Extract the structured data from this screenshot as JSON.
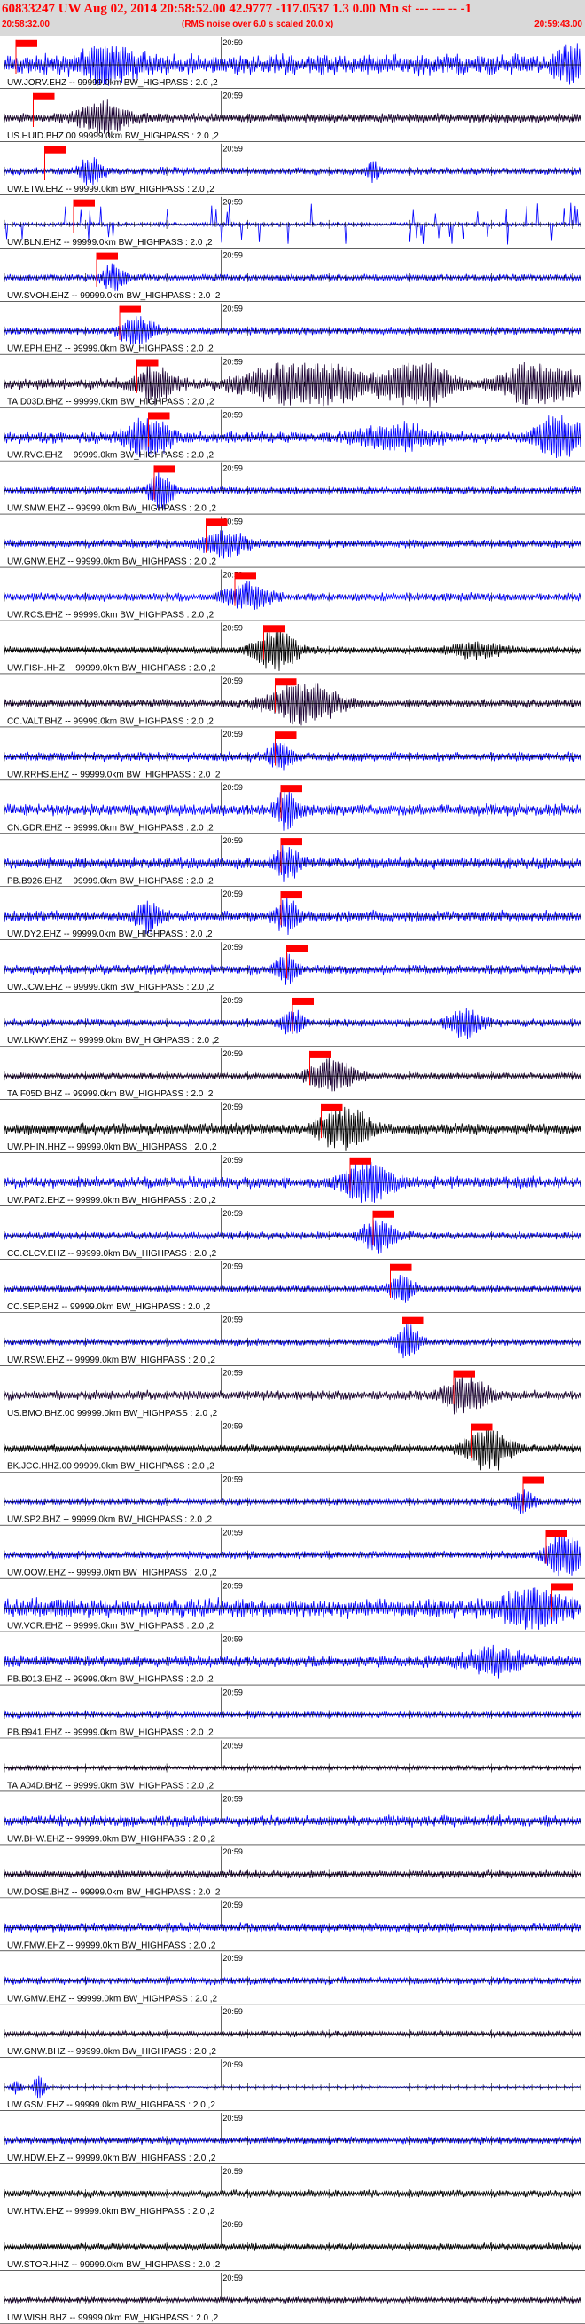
{
  "header": {
    "title": "60833247 UW Aug 02, 2014 20:58:52.00    42.9777 -117.0537  1.3 0.00 Mn st --- --- --  -1",
    "start_time": "20:58:32.00",
    "note": "(RMS noise over 6.0 s scaled 20.0 x)",
    "end_time": "20:59:43.00"
  },
  "chart_data": {
    "type": "line",
    "time_axis": {
      "start": "20:58:32.00",
      "end": "20:59:43.00",
      "tick_label": "20:59"
    },
    "colors": {
      "blue": "#0000ff",
      "dark": "#1a0033",
      "black": "#000000",
      "red": "#ff0000",
      "axis": "#000000"
    },
    "traces": [
      {
        "label": "UW.JORV.EHZ -- 99999.0km BW_HIGHPASS : 2.0 ,2",
        "color": "blue",
        "amplitude": 0.55,
        "pick": 0.02,
        "bursts": [
          [
            0.18,
            0.7,
            0.05
          ],
          [
            0.98,
            0.8,
            0.02
          ]
        ]
      },
      {
        "label": "US.HUID.BHZ.00 99999.0km BW_HIGHPASS : 2.0 ,2",
        "color": "dark",
        "amplitude": 0.25,
        "pick": 0.05,
        "bursts": [
          [
            0.17,
            0.7,
            0.04
          ]
        ]
      },
      {
        "label": "UW.ETW.EHZ -- 99999.0km BW_HIGHPASS : 2.0 ,2",
        "color": "blue",
        "amplitude": 0.2,
        "pick": 0.07,
        "bursts": [
          [
            0.15,
            0.6,
            0.02
          ],
          [
            0.64,
            0.5,
            0.01
          ]
        ]
      },
      {
        "label": "UW.BLN.EHZ -- 99999.0km BW_HIGHPASS : 2.0 ,2",
        "color": "blue",
        "amplitude": 0.1,
        "pick": 0.12,
        "spikes": true,
        "bursts": []
      },
      {
        "label": "UW.SVOH.EHZ -- 99999.0km BW_HIGHPASS : 2.0 ,2",
        "color": "blue",
        "amplitude": 0.18,
        "pick": 0.16,
        "bursts": [
          [
            0.19,
            0.6,
            0.02
          ]
        ]
      },
      {
        "label": "UW.EPH.EHZ -- 99999.0km BW_HIGHPASS : 2.0 ,2",
        "color": "blue",
        "amplitude": 0.2,
        "pick": 0.2,
        "bursts": [
          [
            0.23,
            0.6,
            0.03
          ]
        ]
      },
      {
        "label": "TA.D03D.BHZ -- 99999.0km BW_HIGHPASS : 2.0 ,2",
        "color": "dark",
        "amplitude": 0.3,
        "pick": 0.23,
        "bursts": [
          [
            0.26,
            0.8,
            0.03
          ],
          [
            0.53,
            1.0,
            0.1
          ],
          [
            0.72,
            1.0,
            0.05
          ],
          [
            0.93,
            1.0,
            0.06
          ]
        ]
      },
      {
        "label": "UW.RVC.EHZ -- 99999.0km BW_HIGHPASS : 2.0 ,2",
        "color": "blue",
        "amplitude": 0.3,
        "pick": 0.25,
        "bursts": [
          [
            0.25,
            0.8,
            0.04
          ],
          [
            0.68,
            0.5,
            0.06
          ],
          [
            0.96,
            0.95,
            0.04
          ]
        ]
      },
      {
        "label": "UW.SMW.EHZ -- 99999.0km BW_HIGHPASS : 2.0 ,2",
        "color": "blue",
        "amplitude": 0.2,
        "pick": 0.26,
        "bursts": [
          [
            0.27,
            0.9,
            0.02
          ]
        ]
      },
      {
        "label": "UW.GNW.EHZ -- 99999.0km BW_HIGHPASS : 2.0 ,2",
        "color": "blue",
        "amplitude": 0.22,
        "pick": 0.35,
        "bursts": [
          [
            0.38,
            0.5,
            0.04
          ]
        ]
      },
      {
        "label": "UW.RCS.EHZ -- 99999.0km BW_HIGHPASS : 2.0 ,2",
        "color": "blue",
        "amplitude": 0.22,
        "pick": 0.4,
        "bursts": [
          [
            0.42,
            0.5,
            0.04
          ]
        ]
      },
      {
        "label": "UW.FISH.HHZ -- 99999.0km BW_HIGHPASS : 2.0 ,2",
        "color": "black",
        "amplitude": 0.18,
        "pick": 0.45,
        "bursts": [
          [
            0.47,
            0.8,
            0.04
          ],
          [
            0.82,
            0.3,
            0.05
          ]
        ]
      },
      {
        "label": "CC.VALT.BHZ -- 99999.0km BW_HIGHPASS : 2.0 ,2",
        "color": "dark",
        "amplitude": 0.22,
        "pick": 0.47,
        "bursts": [
          [
            0.52,
            0.9,
            0.06
          ]
        ]
      },
      {
        "label": "UW.RRHS.EHZ -- 99999.0km BW_HIGHPASS : 2.0 ,2",
        "color": "blue",
        "amplitude": 0.25,
        "pick": 0.47,
        "bursts": [
          [
            0.48,
            0.6,
            0.02
          ]
        ]
      },
      {
        "label": "CN.GDR.EHZ -- 99999.0km BW_HIGHPASS : 2.0 ,2",
        "color": "blue",
        "amplitude": 0.3,
        "pick": 0.48,
        "bursts": [
          [
            0.49,
            0.8,
            0.02
          ]
        ]
      },
      {
        "label": "PB.B926.EHZ -- 99999.0km BW_HIGHPASS : 2.0 ,2",
        "color": "blue",
        "amplitude": 0.3,
        "pick": 0.48,
        "bursts": [
          [
            0.49,
            0.7,
            0.02
          ]
        ]
      },
      {
        "label": "UW.DY2.EHZ -- 99999.0km BW_HIGHPASS : 2.0 ,2",
        "color": "blue",
        "amplitude": 0.3,
        "pick": 0.48,
        "bursts": [
          [
            0.49,
            0.7,
            0.02
          ],
          [
            0.25,
            0.6,
            0.02
          ]
        ]
      },
      {
        "label": "UW.JCW.EHZ -- 99999.0km BW_HIGHPASS : 2.0 ,2",
        "color": "blue",
        "amplitude": 0.25,
        "pick": 0.49,
        "bursts": [
          [
            0.49,
            0.6,
            0.02
          ]
        ]
      },
      {
        "label": "UW.LKWY.EHZ -- 99999.0km BW_HIGHPASS : 2.0 ,2",
        "color": "blue",
        "amplitude": 0.2,
        "pick": 0.5,
        "bursts": [
          [
            0.5,
            0.5,
            0.02
          ],
          [
            0.8,
            0.6,
            0.03
          ]
        ]
      },
      {
        "label": "TA.F05D.BHZ -- 99999.0km BW_HIGHPASS : 2.0 ,2",
        "color": "dark",
        "amplitude": 0.18,
        "pick": 0.53,
        "bursts": [
          [
            0.57,
            0.7,
            0.04
          ]
        ]
      },
      {
        "label": "UW.PHIN.HHZ -- 99999.0km BW_HIGHPASS : 2.0 ,2",
        "color": "black",
        "amplitude": 0.3,
        "pick": 0.55,
        "bursts": [
          [
            0.59,
            1.0,
            0.04
          ]
        ]
      },
      {
        "label": "UW.PAT2.EHZ -- 99999.0km BW_HIGHPASS : 2.0 ,2",
        "color": "blue",
        "amplitude": 0.3,
        "pick": 0.6,
        "bursts": [
          [
            0.63,
            0.9,
            0.04
          ]
        ]
      },
      {
        "label": "CC.CLCV.EHZ -- 99999.0km BW_HIGHPASS : 2.0 ,2",
        "color": "blue",
        "amplitude": 0.2,
        "pick": 0.64,
        "bursts": [
          [
            0.65,
            0.7,
            0.03
          ]
        ]
      },
      {
        "label": "CC.SEP.EHZ -- 99999.0km BW_HIGHPASS : 2.0 ,2",
        "color": "blue",
        "amplitude": 0.18,
        "pick": 0.67,
        "bursts": [
          [
            0.69,
            0.6,
            0.02
          ]
        ]
      },
      {
        "label": "UW.RSW.EHZ -- 99999.0km BW_HIGHPASS : 2.0 ,2",
        "color": "blue",
        "amplitude": 0.18,
        "pick": 0.69,
        "bursts": [
          [
            0.7,
            0.8,
            0.02
          ]
        ]
      },
      {
        "label": "US.BMO.BHZ.00 99999.0km BW_HIGHPASS : 2.0 ,2",
        "color": "dark",
        "amplitude": 0.25,
        "pick": 0.78,
        "bursts": [
          [
            0.8,
            0.8,
            0.04
          ]
        ]
      },
      {
        "label": "BK.JCC.HHZ.00 99999.0km BW_HIGHPASS : 2.0 ,2",
        "color": "black",
        "amplitude": 0.2,
        "pick": 0.81,
        "bursts": [
          [
            0.84,
            1.0,
            0.04
          ]
        ]
      },
      {
        "label": "UW.SP2.BHZ -- 99999.0km BW_HIGHPASS : 2.0 ,2",
        "color": "blue",
        "amplitude": 0.15,
        "pick": 0.9,
        "bursts": [
          [
            0.9,
            0.5,
            0.02
          ]
        ]
      },
      {
        "label": "UW.OOW.EHZ -- 99999.0km BW_HIGHPASS : 2.0 ,2",
        "color": "blue",
        "amplitude": 0.2,
        "pick": 0.94,
        "bursts": [
          [
            0.97,
            1.0,
            0.03
          ]
        ]
      },
      {
        "label": "UW.VCR.EHZ -- 99999.0km BW_HIGHPASS : 2.0 ,2",
        "color": "blue",
        "amplitude": 0.5,
        "pick": 0.95,
        "bursts": [
          [
            0.92,
            0.8,
            0.05
          ]
        ]
      },
      {
        "label": "PB.B013.EHZ -- 99999.0km BW_HIGHPASS : 2.0 ,2",
        "color": "blue",
        "amplitude": 0.3,
        "pick": null,
        "bursts": [
          [
            0.85,
            0.5,
            0.05
          ]
        ]
      },
      {
        "label": "PB.B941.EHZ -- 99999.0km BW_HIGHPASS : 2.0 ,2",
        "color": "blue",
        "amplitude": 0.15,
        "pick": null,
        "bursts": []
      },
      {
        "label": "TA.A04D.BHZ -- 99999.0km BW_HIGHPASS : 2.0 ,2",
        "color": "dark",
        "amplitude": 0.12,
        "pick": null,
        "bursts": []
      },
      {
        "label": "UW.BHW.EHZ -- 99999.0km BW_HIGHPASS : 2.0 ,2",
        "color": "blue",
        "amplitude": 0.3,
        "pick": null,
        "bursts": []
      },
      {
        "label": "UW.DOSE.BHZ -- 99999.0km BW_HIGHPASS : 2.0 ,2",
        "color": "dark",
        "amplitude": 0.2,
        "pick": null,
        "bursts": []
      },
      {
        "label": "UW.FMW.EHZ -- 99999.0km BW_HIGHPASS : 2.0 ,2",
        "color": "blue",
        "amplitude": 0.25,
        "pick": null,
        "bursts": []
      },
      {
        "label": "UW.GMW.EHZ -- 99999.0km BW_HIGHPASS : 2.0 ,2",
        "color": "blue",
        "amplitude": 0.2,
        "pick": null,
        "bursts": []
      },
      {
        "label": "UW.GNW.BHZ -- 99999.0km BW_HIGHPASS : 2.0 ,2",
        "color": "dark",
        "amplitude": 0.15,
        "pick": null,
        "bursts": []
      },
      {
        "label": "UW.GSM.EHZ -- 99999.0km BW_HIGHPASS : 2.0 ,2",
        "color": "blue",
        "amplitude": 0.05,
        "pick": null,
        "bursts": [
          [
            0.06,
            0.6,
            0.01
          ],
          [
            0.02,
            0.3,
            0.01
          ]
        ]
      },
      {
        "label": "UW.HDW.EHZ -- 99999.0km BW_HIGHPASS : 2.0 ,2",
        "color": "blue",
        "amplitude": 0.2,
        "pick": null,
        "bursts": []
      },
      {
        "label": "UW.HTW.EHZ -- 99999.0km BW_HIGHPASS : 2.0 ,2",
        "color": "black",
        "amplitude": 0.2,
        "pick": null,
        "bursts": []
      },
      {
        "label": "UW.STOR.HHZ -- 99999.0km BW_HIGHPASS : 2.0 ,2",
        "color": "black",
        "amplitude": 0.2,
        "pick": null,
        "bursts": []
      },
      {
        "label": "UW.WISH.BHZ -- 99999.0km BW_HIGHPASS : 2.0 ,2",
        "color": "dark",
        "amplitude": 0.15,
        "pick": null,
        "bursts": []
      }
    ]
  }
}
